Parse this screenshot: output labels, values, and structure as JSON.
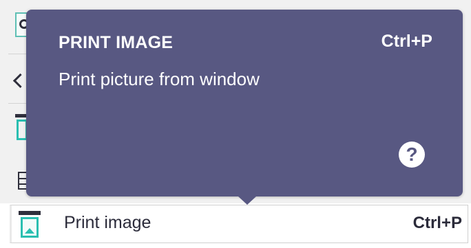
{
  "tooltip": {
    "title": "PRINT IMAGE",
    "shortcut": "Ctrl+P",
    "description": "Print picture from window",
    "help_glyph": "?"
  },
  "menu_item": {
    "label": "Print image",
    "shortcut": "Ctrl+P",
    "icon": "print-image-icon"
  },
  "toolbar_icons": [
    "search-icon",
    "chevron-left-icon",
    "print-image-icon",
    "grid-icon"
  ],
  "colors": {
    "tooltip_bg": "#585882",
    "accent": "#2abfb1",
    "text_dark": "#2b2b3a"
  }
}
